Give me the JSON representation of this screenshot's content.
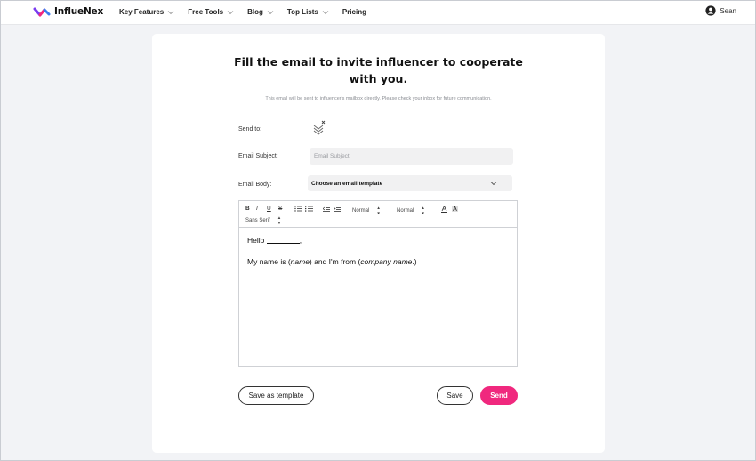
{
  "brand": {
    "name": "InflueNex"
  },
  "nav": [
    {
      "label": "Key Features",
      "dropdown": true
    },
    {
      "label": "Free Tools",
      "dropdown": true
    },
    {
      "label": "Blog",
      "dropdown": true
    },
    {
      "label": "Top Lists",
      "dropdown": true
    },
    {
      "label": "Pricing",
      "dropdown": false
    }
  ],
  "user": {
    "name": "Sean"
  },
  "form": {
    "title_line1": "Fill the email to invite influencer to cooperate",
    "title_line2": "with you.",
    "subtitle": "This email will be sent to influencer's mailbox directly. Please check your inbox for future communication.",
    "send_to_label": "Send to:",
    "subject_label": "Email Subject:",
    "subject_placeholder": "Email Subject",
    "subject_value": "",
    "body_label": "Email Body:",
    "template_select": "Choose an email template"
  },
  "editor": {
    "toolbar": {
      "bold": "B",
      "italic": "I",
      "underline": "U",
      "strike": "S",
      "heading_select": "Normal",
      "size_select": "Normal",
      "font_select": "Sans Serif"
    },
    "line1_prefix": "Hello ",
    "line1_suffix": ",",
    "line2_a": "My name is (",
    "line2_name": "name",
    "line2_b": ") and I'm from (",
    "line2_company": "company name",
    "line2_c": ".)"
  },
  "buttons": {
    "save_template": "Save as template",
    "save": "Save",
    "send": "Send"
  },
  "colors": {
    "accent": "#f0287e",
    "background": "#f2f3f6",
    "card": "#ffffff"
  }
}
